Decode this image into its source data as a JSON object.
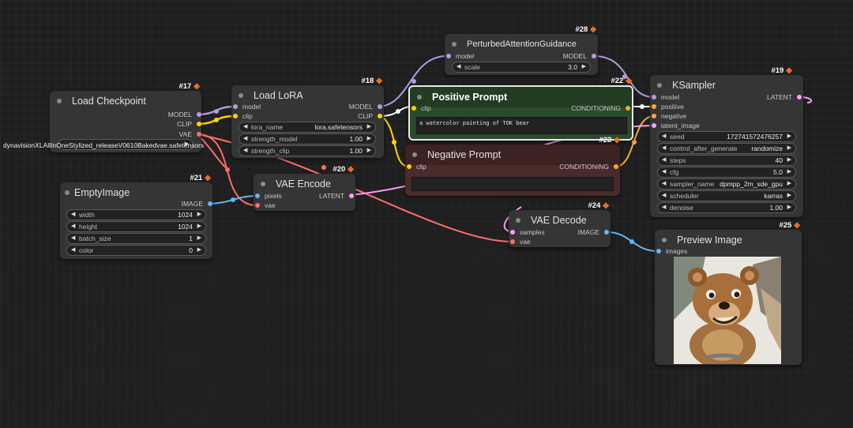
{
  "nodes": {
    "load_checkpoint": {
      "title": "Load Checkpoint",
      "id": "#17",
      "outputs": [
        "MODEL",
        "CLIP",
        "VAE"
      ],
      "ckpt_name": "dynavisionXLAllInOneStylized_releaseV0610Bakedvae.safetensors"
    },
    "load_lora": {
      "title": "Load LoRA",
      "id": "#18",
      "inputs": [
        "model",
        "clip"
      ],
      "outputs": [
        "MODEL",
        "CLIP"
      ],
      "widgets": [
        {
          "label": "lora_name",
          "value": "lora.safetensors"
        },
        {
          "label": "strength_model",
          "value": "1.00"
        },
        {
          "label": "strength_clip",
          "value": "1.00"
        }
      ]
    },
    "pag": {
      "title": "PerturbedAttentionGuidance",
      "id": "#28",
      "inputs": [
        "model"
      ],
      "outputs": [
        "MODEL"
      ],
      "widgets": [
        {
          "label": "scale",
          "value": "3.0"
        }
      ]
    },
    "positive": {
      "title": "Positive Prompt",
      "id": "#22",
      "inputs": [
        "clip"
      ],
      "outputs": [
        "CONDITIONING"
      ],
      "text": "a watercolor painting of TOK bear"
    },
    "negative": {
      "title": "Negative Prompt",
      "id": "#23",
      "inputs": [
        "clip"
      ],
      "outputs": [
        "CONDITIONING"
      ],
      "text": ""
    },
    "ksampler": {
      "title": "KSampler",
      "id": "#19",
      "inputs": [
        "model",
        "positive",
        "negative",
        "latent_image"
      ],
      "outputs": [
        "LATENT"
      ],
      "widgets": [
        {
          "label": "seed",
          "value": "172741572476257"
        },
        {
          "label": "control_after_generate",
          "value": "randomize"
        },
        {
          "label": "steps",
          "value": "40"
        },
        {
          "label": "cfg",
          "value": "5.0"
        },
        {
          "label": "sampler_name",
          "value": "dpmpp_2m_sde_gpu"
        },
        {
          "label": "scheduler",
          "value": "karras"
        },
        {
          "label": "denoise",
          "value": "1.00"
        }
      ]
    },
    "empty_image": {
      "title": "EmptyImage",
      "id": "#21",
      "outputs": [
        "IMAGE"
      ],
      "widgets": [
        {
          "label": "width",
          "value": "1024"
        },
        {
          "label": "height",
          "value": "1024"
        },
        {
          "label": "batch_size",
          "value": "1"
        },
        {
          "label": "color",
          "value": "0"
        }
      ]
    },
    "vae_encode": {
      "title": "VAE Encode",
      "id": "#20",
      "inputs": [
        "pixels",
        "vae"
      ],
      "outputs": [
        "LATENT"
      ]
    },
    "vae_decode": {
      "title": "VAE Decode",
      "id": "#24",
      "inputs": [
        "samples",
        "vae"
      ],
      "outputs": [
        "IMAGE"
      ]
    },
    "preview": {
      "title": "Preview Image",
      "id": "#25",
      "inputs": [
        "images"
      ]
    }
  },
  "colors": {
    "model": "#b39ddb",
    "clip": "#ffd500",
    "vae": "#ff6e6e",
    "conditioning": "#ffa931",
    "latent": "#ff9cf9",
    "image": "#64b5f6",
    "positive_bg": "#2c4a2c",
    "negative_bg": "#4a2b2b"
  },
  "icons": [
    "fox-badge-icon",
    "left-arrow-icon",
    "right-arrow-icon",
    "bear-preview-image"
  ]
}
